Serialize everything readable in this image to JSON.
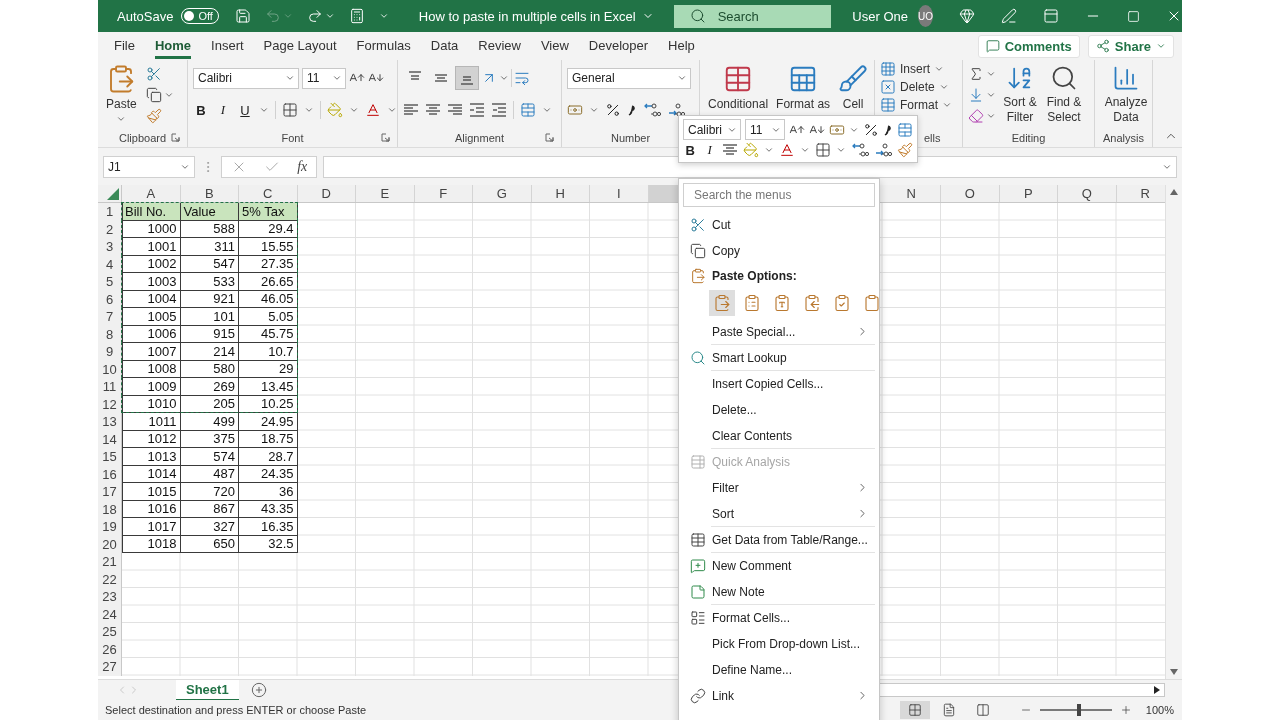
{
  "title_bar": {
    "autosave_label": "AutoSave",
    "autosave": {
      "on": false,
      "label": "Off"
    },
    "undo_disabled": true,
    "document_title": "How to paste in multiple cells in Excel",
    "search_placeholder": "Search",
    "user_name": "User One",
    "avatar_initials": "UO"
  },
  "ribbon_tabs": [
    {
      "label": "File",
      "selected": false
    },
    {
      "label": "Home",
      "selected": true
    },
    {
      "label": "Insert",
      "selected": false
    },
    {
      "label": "Page Layout",
      "selected": false
    },
    {
      "label": "Formulas",
      "selected": false
    },
    {
      "label": "Data",
      "selected": false
    },
    {
      "label": "Review",
      "selected": false
    },
    {
      "label": "View",
      "selected": false
    },
    {
      "label": "Developer",
      "selected": false
    },
    {
      "label": "Help",
      "selected": false
    }
  ],
  "comments_button": "Comments",
  "share_button": "Share",
  "ribbon": {
    "clipboard": {
      "paste_label": "Paste",
      "group_label": "Clipboard"
    },
    "font": {
      "font_name": "Calibri",
      "font_size": "11",
      "bold": "B",
      "italic": "I",
      "underline": "U",
      "group_label": "Font"
    },
    "alignment": {
      "vertical_align": [
        {
          "selected": false
        },
        {
          "selected": false
        },
        {
          "selected": true
        }
      ],
      "group_label": "Alignment"
    },
    "number": {
      "format": "General",
      "group_label": "Number"
    },
    "styles": [
      {
        "label": "Conditional"
      },
      {
        "label": "Format as"
      },
      {
        "label": "Cell"
      }
    ],
    "cells": {
      "items": [
        "Insert",
        "Delete",
        "Format"
      ],
      "group_label": "ells"
    },
    "editing": {
      "sort_label": "Sort & Filter",
      "find_label": "Find & Select",
      "group_label": "Editing"
    },
    "analysis": {
      "label": "Analyze Data",
      "group_label": "Analysis"
    }
  },
  "formula_bar": {
    "name_box": "J1",
    "fx": "fx"
  },
  "sheet": {
    "columns_left": [
      "A",
      "B",
      "C",
      "D",
      "E",
      "F",
      "G",
      "H",
      "I"
    ],
    "columns_right": [
      "N",
      "O",
      "P",
      "Q",
      "R"
    ],
    "rows": [
      {
        "number": "1",
        "kind": "header",
        "copied": true,
        "cells": [
          "Bill No.",
          "Value",
          "5% Tax"
        ]
      },
      {
        "number": "2",
        "kind": "data",
        "copied": true,
        "cells": [
          "1000",
          "588",
          "29.4"
        ]
      },
      {
        "number": "3",
        "kind": "data",
        "copied": true,
        "cells": [
          "1001",
          "311",
          "15.55"
        ]
      },
      {
        "number": "4",
        "kind": "data",
        "copied": true,
        "cells": [
          "1002",
          "547",
          "27.35"
        ]
      },
      {
        "number": "5",
        "kind": "data",
        "copied": true,
        "cells": [
          "1003",
          "533",
          "26.65"
        ]
      },
      {
        "number": "6",
        "kind": "data",
        "copied": true,
        "cells": [
          "1004",
          "921",
          "46.05"
        ]
      },
      {
        "number": "7",
        "kind": "data",
        "copied": true,
        "cells": [
          "1005",
          "101",
          "5.05"
        ]
      },
      {
        "number": "8",
        "kind": "data",
        "copied": true,
        "cells": [
          "1006",
          "915",
          "45.75"
        ]
      },
      {
        "number": "9",
        "kind": "data",
        "copied": true,
        "cells": [
          "1007",
          "214",
          "10.7"
        ]
      },
      {
        "number": "10",
        "kind": "data",
        "copied": true,
        "cells": [
          "1008",
          "580",
          "29"
        ]
      },
      {
        "number": "11",
        "kind": "data",
        "copied": true,
        "cells": [
          "1009",
          "269",
          "13.45"
        ]
      },
      {
        "number": "12",
        "kind": "data",
        "copied": true,
        "cells": [
          "1010",
          "205",
          "10.25"
        ]
      },
      {
        "number": "13",
        "kind": "data",
        "copied": false,
        "cells": [
          "1011",
          "499",
          "24.95"
        ]
      },
      {
        "number": "14",
        "kind": "data",
        "copied": false,
        "cells": [
          "1012",
          "375",
          "18.75"
        ]
      },
      {
        "number": "15",
        "kind": "data",
        "copied": false,
        "cells": [
          "1013",
          "574",
          "28.7"
        ]
      },
      {
        "number": "16",
        "kind": "data",
        "copied": false,
        "cells": [
          "1014",
          "487",
          "24.35"
        ]
      },
      {
        "number": "17",
        "kind": "data",
        "copied": false,
        "cells": [
          "1015",
          "720",
          "36"
        ]
      },
      {
        "number": "18",
        "kind": "data",
        "copied": false,
        "cells": [
          "1016",
          "867",
          "43.35"
        ]
      },
      {
        "number": "19",
        "kind": "data",
        "copied": false,
        "cells": [
          "1017",
          "327",
          "16.35"
        ]
      },
      {
        "number": "20",
        "kind": "data",
        "copied": false,
        "cells": [
          "1018",
          "650",
          "32.5"
        ]
      },
      {
        "number": "21",
        "kind": "empty",
        "copied": false
      },
      {
        "number": "22",
        "kind": "empty",
        "copied": false
      },
      {
        "number": "23",
        "kind": "empty",
        "copied": false
      },
      {
        "number": "24",
        "kind": "empty",
        "copied": false
      },
      {
        "number": "25",
        "kind": "empty",
        "copied": false
      },
      {
        "number": "26",
        "kind": "empty",
        "copied": false
      },
      {
        "number": "27",
        "kind": "empty",
        "copied": false
      }
    ]
  },
  "mini_toolbar": {
    "font_name": "Calibri",
    "font_size": "11",
    "bold": "B",
    "italic": "I"
  },
  "context_menu": {
    "search_placeholder": "Search the menus",
    "items": [
      {
        "kind": "item",
        "label": "Cut",
        "divider_above": false,
        "submenu": false,
        "disabled": false
      },
      {
        "kind": "item",
        "label": "Copy",
        "divider_above": false,
        "submenu": false,
        "disabled": false
      },
      {
        "kind": "header",
        "label": "Paste Options:"
      },
      {
        "kind": "paste_icons",
        "options": [
          {
            "selected": true
          },
          {
            "selected": false
          },
          {
            "selected": false
          },
          {
            "selected": false
          },
          {
            "selected": false
          },
          {
            "selected": false
          }
        ]
      },
      {
        "kind": "item",
        "label": "Paste Special...",
        "divider_above": false,
        "submenu": true,
        "disabled": false
      },
      {
        "kind": "item",
        "label": "Smart Lookup",
        "divider_above": true,
        "submenu": false,
        "disabled": false
      },
      {
        "kind": "item",
        "label": "Insert Copied Cells...",
        "divider_above": true,
        "submenu": false,
        "disabled": false
      },
      {
        "kind": "item",
        "label": "Delete...",
        "divider_above": false,
        "submenu": false,
        "disabled": false
      },
      {
        "kind": "item",
        "label": "Clear Contents",
        "divider_above": false,
        "submenu": false,
        "disabled": false
      },
      {
        "kind": "item",
        "label": "Quick Analysis",
        "divider_above": true,
        "submenu": false,
        "disabled": true
      },
      {
        "kind": "item",
        "label": "Filter",
        "divider_above": false,
        "submenu": true,
        "disabled": false
      },
      {
        "kind": "item",
        "label": "Sort",
        "divider_above": false,
        "submenu": true,
        "disabled": false
      },
      {
        "kind": "item",
        "label": "Get Data from Table/Range...",
        "divider_above": true,
        "submenu": false,
        "disabled": false
      },
      {
        "kind": "item",
        "label": "New Comment",
        "divider_above": true,
        "submenu": false,
        "disabled": false
      },
      {
        "kind": "item",
        "label": "New Note",
        "divider_above": false,
        "submenu": false,
        "disabled": false
      },
      {
        "kind": "item",
        "label": "Format Cells...",
        "divider_above": true,
        "submenu": false,
        "disabled": false
      },
      {
        "kind": "item",
        "label": "Pick From Drop-down List...",
        "divider_above": false,
        "submenu": false,
        "disabled": false
      },
      {
        "kind": "item",
        "label": "Define Name...",
        "divider_above": false,
        "submenu": false,
        "disabled": false
      },
      {
        "kind": "item",
        "label": "Link",
        "divider_above": false,
        "submenu": true,
        "disabled": false
      }
    ]
  },
  "sheet_tabs": [
    {
      "label": "Sheet1",
      "selected": true
    }
  ],
  "status_bar": {
    "message": "Select destination and press ENTER or choose Paste",
    "views": [
      {
        "selected": true
      },
      {
        "selected": false
      },
      {
        "selected": false
      }
    ],
    "zoom": {
      "level": 0.55,
      "label": "100%"
    }
  }
}
